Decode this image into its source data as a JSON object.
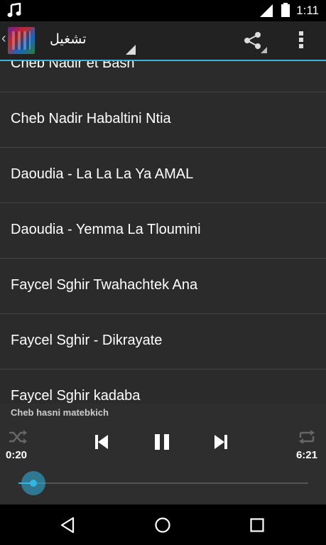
{
  "status": {
    "time": "1:11"
  },
  "action_bar": {
    "title": "تشغيل"
  },
  "songs": [
    "Cheb Nadir et Bash",
    "Cheb Nadir Habaltini Ntia",
    "Daoudia - La La La Ya AMAL",
    "Daoudia - Yemma La Tloumini",
    "Faycel Sghir Twahachtek Ana",
    "Faycel Sghir - Dikrayate",
    "Faycel Sghir kadaba"
  ],
  "player": {
    "now_playing": "Cheb hasni matebkich",
    "elapsed": "0:20",
    "duration": "6:21",
    "progress_fraction": 0.052
  },
  "icons": {
    "status": [
      "music-note-icon",
      "signal-icon",
      "battery-icon"
    ],
    "action_bar": [
      "back-chevron-icon",
      "app-icon",
      "share-icon",
      "overflow-menu-icon"
    ],
    "player": [
      "shuffle-icon",
      "previous-icon",
      "pause-icon",
      "next-icon",
      "repeat-icon"
    ],
    "navigation": [
      "nav-back-icon",
      "nav-home-icon",
      "nav-recents-icon"
    ]
  },
  "colors": {
    "accent": "#33b5e5",
    "background": "#2b2b2b",
    "bars": "#000000"
  }
}
